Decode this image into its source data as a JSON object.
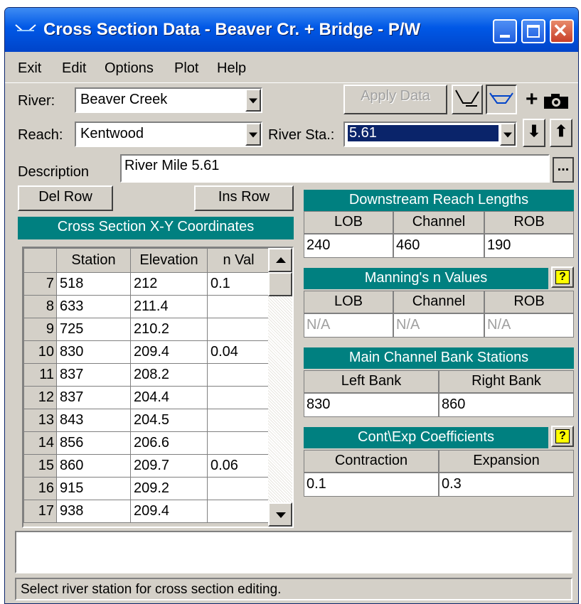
{
  "window": {
    "title": "Cross Section Data - Beaver Cr. + Bridge - P/W"
  },
  "menu": {
    "items": [
      "Exit",
      "Edit",
      "Options",
      "Plot",
      "Help"
    ]
  },
  "river": {
    "label": "River:",
    "value": "Beaver Creek"
  },
  "reach": {
    "label": "Reach:",
    "value": "Kentwood"
  },
  "river_sta": {
    "label": "River Sta.:",
    "value": "5.61"
  },
  "apply_data": "Apply Data",
  "description": {
    "label": "Description",
    "value": "River Mile 5.61",
    "more_button": "..."
  },
  "del_row": "Del Row",
  "ins_row": "Ins Row",
  "coords": {
    "title": "Cross Section X-Y Coordinates",
    "columns": [
      "Station",
      "Elevation",
      "n Val"
    ],
    "rows": [
      {
        "n": "7",
        "station": "518",
        "elev": "212",
        "nval": "0.1"
      },
      {
        "n": "8",
        "station": "633",
        "elev": "211.4",
        "nval": ""
      },
      {
        "n": "9",
        "station": "725",
        "elev": "210.2",
        "nval": ""
      },
      {
        "n": "10",
        "station": "830",
        "elev": "209.4",
        "nval": "0.04"
      },
      {
        "n": "11",
        "station": "837",
        "elev": "208.2",
        "nval": ""
      },
      {
        "n": "12",
        "station": "837",
        "elev": "204.4",
        "nval": ""
      },
      {
        "n": "13",
        "station": "843",
        "elev": "204.5",
        "nval": ""
      },
      {
        "n": "14",
        "station": "856",
        "elev": "206.6",
        "nval": ""
      },
      {
        "n": "15",
        "station": "860",
        "elev": "209.7",
        "nval": "0.06"
      },
      {
        "n": "16",
        "station": "915",
        "elev": "209.2",
        "nval": ""
      },
      {
        "n": "17",
        "station": "938",
        "elev": "209.4",
        "nval": ""
      }
    ]
  },
  "reach_lengths": {
    "title": "Downstream Reach Lengths",
    "lob_label": "LOB",
    "channel_label": "Channel",
    "rob_label": "ROB",
    "lob": "240",
    "channel": "460",
    "rob": "190"
  },
  "mannings": {
    "title": "Manning's n Values",
    "lob_label": "LOB",
    "channel_label": "Channel",
    "rob_label": "ROB",
    "lob": "N/A",
    "channel": "N/A",
    "rob": "N/A",
    "help": "?"
  },
  "bank_stations": {
    "title": "Main Channel Bank Stations",
    "left_label": "Left Bank",
    "right_label": "Right Bank",
    "left": "830",
    "right": "860"
  },
  "coefficients": {
    "title": "Cont\\Exp  Coefficients",
    "contraction_label": "Contraction",
    "expansion_label": "Expansion",
    "contraction": "0.1",
    "expansion": "0.3",
    "help": "?"
  },
  "status_text": "Select river station for cross section editing.",
  "colors": {
    "panel_header": "#008080",
    "title_bar": "#0058e6",
    "selected": "#0a246a",
    "face": "#d4d0c8"
  }
}
